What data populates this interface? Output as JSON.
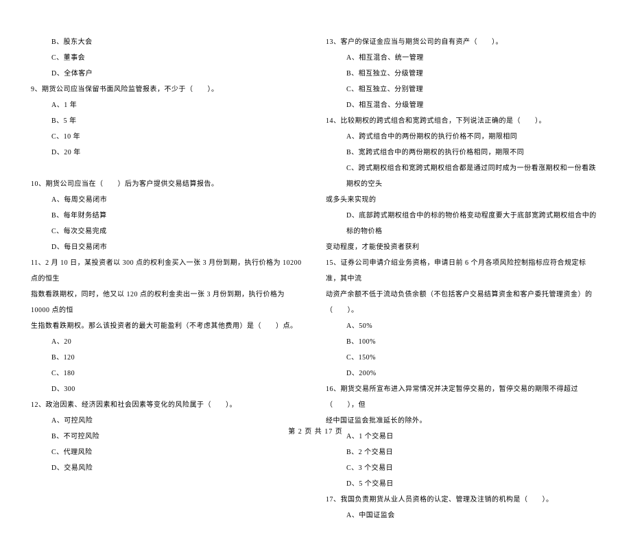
{
  "left_column": [
    {
      "cls": "indent-1",
      "text": "B、股东大会"
    },
    {
      "cls": "indent-1",
      "text": "C、董事会"
    },
    {
      "cls": "indent-1",
      "text": "D、全体客户"
    },
    {
      "cls": "indent-q",
      "text": "9、期货公司应当保留书面风险监管报表，不少于（　　）。"
    },
    {
      "cls": "indent-1",
      "text": "A、1 年"
    },
    {
      "cls": "indent-1",
      "text": "B、5 年"
    },
    {
      "cls": "indent-1",
      "text": "C、10 年"
    },
    {
      "cls": "indent-1",
      "text": "D、20 年"
    },
    {
      "cls": "indent-q",
      "text": "　"
    },
    {
      "cls": "indent-q",
      "text": "10、期货公司应当在（　　）后为客户提供交易结算报告。"
    },
    {
      "cls": "indent-1",
      "text": "A、每周交易闭市"
    },
    {
      "cls": "indent-1",
      "text": "B、每年财务结算"
    },
    {
      "cls": "indent-1",
      "text": "C、每次交易完成"
    },
    {
      "cls": "indent-1",
      "text": "D、每日交易闭市"
    },
    {
      "cls": "indent-q",
      "text": "11、2 月 10 日，某投资者以 300 点的权利金买入一张 3 月份到期，执行价格为 10200 点的恒生"
    },
    {
      "cls": "indent-q",
      "text": "指数看跌期权，同时，他又以 120 点的权利金卖出一张 3 月份到期，执行价格为 10000 点的恒"
    },
    {
      "cls": "indent-q",
      "text": "生指数看跌期权。那么该投资者的最大可能盈利（不考虑其他费用）是（　　）点。"
    },
    {
      "cls": "indent-1",
      "text": "A、20"
    },
    {
      "cls": "indent-1",
      "text": "B、120"
    },
    {
      "cls": "indent-1",
      "text": "C、180"
    },
    {
      "cls": "indent-1",
      "text": "D、300"
    },
    {
      "cls": "indent-q",
      "text": "12、政治因素、经济因素和社会因素等变化的风险属于（　　）。"
    },
    {
      "cls": "indent-1",
      "text": "A、可控风险"
    },
    {
      "cls": "indent-1",
      "text": "B、不可控风险"
    },
    {
      "cls": "indent-1",
      "text": "C、代理风险"
    },
    {
      "cls": "indent-1",
      "text": "D、交易风险"
    }
  ],
  "right_column": [
    {
      "cls": "indent-q",
      "text": "13、客户的保证金应当与期货公司的自有资产（　　）。"
    },
    {
      "cls": "indent-1",
      "text": "A、相互混合、统一管理"
    },
    {
      "cls": "indent-1",
      "text": "B、相互独立、分级管理"
    },
    {
      "cls": "indent-1",
      "text": "C、相互独立、分别管理"
    },
    {
      "cls": "indent-1",
      "text": "D、相互混合、分级管理"
    },
    {
      "cls": "indent-q",
      "text": "14、比较期权的跨式组合和宽跨式组合，下列说法正确的是（　　）。"
    },
    {
      "cls": "indent-1",
      "text": "A、跨式组合中的两份期权的执行价格不同，期限相同"
    },
    {
      "cls": "indent-1",
      "text": "B、宽跨式组合中的两份期权的执行价格相同，期限不同"
    },
    {
      "cls": "indent-1",
      "text": "C、跨式期权组合和宽跨式期权组合都是通过同时成为一份看涨期权和一份看跌期权的空头"
    },
    {
      "cls": "indent-q",
      "text": "或多头来实现的"
    },
    {
      "cls": "indent-1",
      "text": "D、底部跨式期权组合中的标的物价格变动程度要大于底部宽跨式期权组合中的标的物价格"
    },
    {
      "cls": "indent-q",
      "text": "变动程度，才能使投资者获利"
    },
    {
      "cls": "indent-q",
      "text": "15、证券公司申请介绍业务资格，申请日前 6 个月各项风险控制指标应符合规定标准，其中流"
    },
    {
      "cls": "indent-q",
      "text": "动资产余额不低于流动负债余额（不包括客户交易结算资金和客户委托管理资金）的（　　）。"
    },
    {
      "cls": "indent-1",
      "text": "A、50%"
    },
    {
      "cls": "indent-1",
      "text": "B、100%"
    },
    {
      "cls": "indent-1",
      "text": "C、150%"
    },
    {
      "cls": "indent-1",
      "text": "D、200%"
    },
    {
      "cls": "indent-q",
      "text": "16、期货交易所宣布进入异常情况并决定暂停交易的，暂停交易的期限不得超过（　　），但"
    },
    {
      "cls": "indent-q",
      "text": "经中国证监会批准延长的除外。"
    },
    {
      "cls": "indent-1",
      "text": "A、1 个交易日"
    },
    {
      "cls": "indent-1",
      "text": "B、2 个交易日"
    },
    {
      "cls": "indent-1",
      "text": "C、3 个交易日"
    },
    {
      "cls": "indent-1",
      "text": "D、5 个交易日"
    },
    {
      "cls": "indent-q",
      "text": "17、我国负责期货从业人员资格的认定、管理及注销的机构是（　　）。"
    },
    {
      "cls": "indent-1",
      "text": "A、中国证监会"
    }
  ],
  "footer": "第 2 页 共 17 页"
}
